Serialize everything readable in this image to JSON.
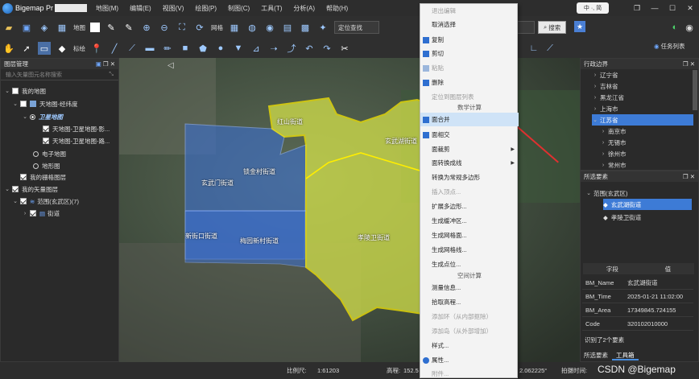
{
  "app": {
    "name": "Bigemap Pr",
    "menu": [
      "地图(M)",
      "编辑(E)",
      "视图(V)",
      "绘图(P)",
      "制图(C)",
      "工具(T)",
      "分析(A)",
      "帮助(H)"
    ],
    "ime_text": "中 ·, 简"
  },
  "toolbar1": {
    "map_label": "地图",
    "grid_label": "网格",
    "locate_combo": "定位查找",
    "search_label": "搜索"
  },
  "toolbar2": {
    "annotate_label": "标绘",
    "task_list_label": "任务列表"
  },
  "left_panel": {
    "title": "图层管理",
    "search_placeholder": "输入矢量图元名称搜索",
    "tree": [
      "我的地图",
      "天地图-经纬度",
      "卫星地图",
      "天地图-卫星地图-影...",
      "天地图-卫星地图-路...",
      "电子地图",
      "地形图",
      "我的栅格图层",
      "我的矢量图层",
      "范围(玄武区)(7)",
      "街道"
    ]
  },
  "map": {
    "labels": [
      "红山街道",
      "锁金村街道",
      "玄武门街道",
      "新街口街道",
      "梅园新村街道",
      "玄武湖街道",
      "孝陵卫街道"
    ],
    "colors": {
      "blue_region": "#3b6fd1",
      "yellow_region": "#d8e64a",
      "outline": "#ffee00"
    }
  },
  "context_menu": {
    "items": [
      {
        "label": "退出编辑",
        "state": "disabled"
      },
      {
        "label": "取消选择",
        "state": "normal"
      },
      {
        "label": "复制",
        "state": "normal",
        "icon": "copy-icon"
      },
      {
        "label": "剪切",
        "state": "normal",
        "icon": "cut-icon"
      },
      {
        "label": "粘贴",
        "state": "disabled",
        "icon": "paste-icon"
      },
      {
        "label": "删除",
        "state": "normal",
        "icon": "delete-icon"
      },
      {
        "label": "定位到图层列表",
        "state": "disabled"
      },
      {
        "label": "数学计算",
        "state": "section"
      },
      {
        "label": "面合并",
        "state": "highlight",
        "icon": "merge-icon"
      },
      {
        "label": "面相交",
        "state": "normal",
        "icon": "intersect-icon"
      },
      {
        "label": "面裁剪",
        "state": "normal",
        "submenu": true
      },
      {
        "label": "面转换成线",
        "state": "normal",
        "submenu": true
      },
      {
        "label": "转换为常规多边形",
        "state": "normal"
      },
      {
        "label": "插入顶点...",
        "state": "disabled"
      },
      {
        "label": "扩展多边形...",
        "state": "normal"
      },
      {
        "label": "生成缓冲区...",
        "state": "normal"
      },
      {
        "label": "生成网格面...",
        "state": "normal"
      },
      {
        "label": "生成网格线...",
        "state": "normal"
      },
      {
        "label": "生成点位...",
        "state": "normal"
      },
      {
        "label": "空间计算",
        "state": "section"
      },
      {
        "label": "测量信息...",
        "state": "normal"
      },
      {
        "label": "拾取高程...",
        "state": "normal"
      },
      {
        "label": "添加环（从内部抠除）",
        "state": "disabled"
      },
      {
        "label": "添加岛（从外部增加）",
        "state": "disabled"
      },
      {
        "label": "样式...",
        "state": "normal"
      },
      {
        "label": "属性...",
        "state": "normal",
        "icon": "info-icon"
      },
      {
        "label": "附件...",
        "state": "disabled"
      }
    ]
  },
  "right_panel": {
    "admin_title": "行政边界",
    "admin_items": [
      "辽宁省",
      "吉林省",
      "黑龙江省",
      "上海市",
      "江苏省",
      "南京市",
      "无锡市",
      "徐州市",
      "常州市"
    ],
    "selected_title": "所选要素",
    "selected_root": "范围(玄武区)",
    "selected_items": [
      "玄武湖街道",
      "孝陵卫街道"
    ],
    "attr_headers": [
      "字段",
      "值"
    ],
    "attrs": [
      {
        "k": "BM_Name",
        "v": "玄武湖街道"
      },
      {
        "k": "BM_Time",
        "v": "2025-01-21 11:02:00"
      },
      {
        "k": "BM_Area",
        "v": "17349845.724155"
      },
      {
        "k": "Code",
        "v": "320102010000"
      }
    ],
    "identified": "识别了2个要素",
    "bottom_tabs": [
      "所选要素",
      "工具箱"
    ]
  },
  "status": {
    "scale_label": "比例尺:",
    "scale_value": "1:61203",
    "elev_label": "高程:",
    "elev_value": "152.5",
    "coord": "2.062225°",
    "time_label": "拍摄时间:",
    "watermark": "CSDN @Bigemap"
  }
}
